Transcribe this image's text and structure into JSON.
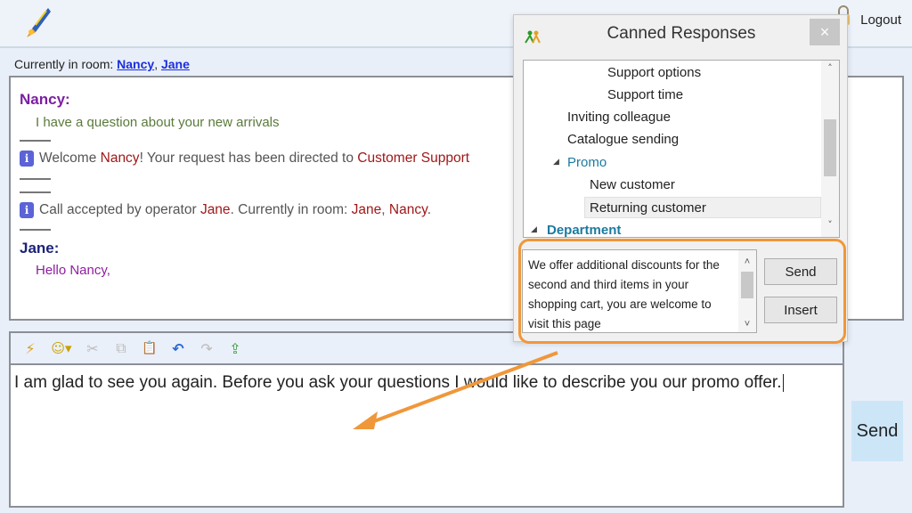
{
  "header": {
    "logo_icon": "rocket-pen-icon",
    "lock_icon": "lock-icon",
    "logout_label": "Logout"
  },
  "room": {
    "label": "Currently in room:",
    "participants": [
      "Nancy",
      "Jane"
    ],
    "separator": ","
  },
  "chat": {
    "messages": [
      {
        "type": "user",
        "sender": "Nancy:",
        "text": "I have a question about your new arrivals",
        "sender_color": "#7b1fa2"
      },
      {
        "type": "info",
        "icon": "info-icon",
        "parts": [
          "Welcome ",
          "Nancy",
          "! Your request has been directed to ",
          "Customer Support"
        ]
      },
      {
        "type": "info",
        "icon": "info-icon",
        "parts": [
          "Call accepted by operator ",
          "Jane",
          ". Currently in room: ",
          "Jane",
          ", ",
          "Nancy",
          "."
        ]
      },
      {
        "type": "user",
        "sender": "Jane:",
        "text": "Hello Nancy,",
        "sender_color": "#1b237a"
      }
    ]
  },
  "toolbar": {
    "items": [
      {
        "name": "insert-canned-icon",
        "glyph": "⚡",
        "enabled": true
      },
      {
        "name": "emoticon-icon",
        "glyph": "☺▾",
        "enabled": true
      },
      {
        "name": "cut-icon",
        "glyph": "✂",
        "enabled": false
      },
      {
        "name": "copy-icon",
        "glyph": "⧉",
        "enabled": false
      },
      {
        "name": "paste-icon",
        "glyph": "📋",
        "enabled": true
      },
      {
        "name": "undo-icon",
        "glyph": "↶",
        "enabled": true
      },
      {
        "name": "redo-icon",
        "glyph": "↷",
        "enabled": false
      },
      {
        "name": "send-file-icon",
        "glyph": "⇪",
        "enabled": true
      }
    ]
  },
  "editor": {
    "value": "I am glad to see you again. Before you ask your questions I would like to describe you our promo offer."
  },
  "send_button": {
    "label": "Send"
  },
  "canned": {
    "title": "Canned Responses",
    "icon": "agents-icon",
    "close_label": "×",
    "tree": [
      {
        "label": "Support options",
        "level": 3,
        "category": false,
        "expanded": null,
        "selected": false
      },
      {
        "label": "Support time",
        "level": 3,
        "category": false,
        "expanded": null,
        "selected": false
      },
      {
        "label": "Inviting colleague",
        "level": 2,
        "category": false,
        "expanded": null,
        "selected": false
      },
      {
        "label": "Catalogue sending",
        "level": 2,
        "category": false,
        "expanded": null,
        "selected": false
      },
      {
        "label": "Promo",
        "level": 2,
        "category": true,
        "expanded": true,
        "selected": false
      },
      {
        "label": "New customer",
        "level": 3,
        "category": false,
        "expanded": null,
        "selected": false
      },
      {
        "label": "Returning customer",
        "level": 3,
        "category": false,
        "expanded": null,
        "selected": true
      },
      {
        "label": "Department",
        "level": 1,
        "category": true,
        "expanded": true,
        "selected": false
      }
    ],
    "preview_text": "We offer additional discounts for the second and third items in your shopping cart, you are welcome to visit this page http://www.myonlinestore/",
    "send_label": "Send",
    "insert_label": "Insert"
  },
  "annotation": {
    "highlight_color": "#f0973a"
  }
}
